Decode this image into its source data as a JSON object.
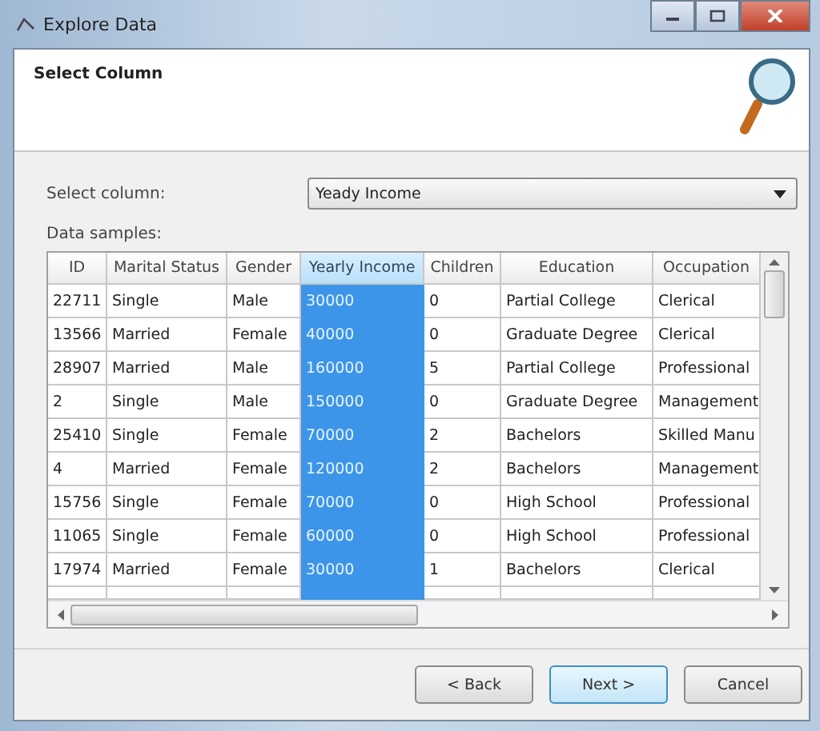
{
  "window": {
    "title": "Explore Data"
  },
  "header": {
    "title": "Select Column"
  },
  "select_column": {
    "label": "Select column:",
    "value": "Yeady Income"
  },
  "data_samples": {
    "label": "Data samples:"
  },
  "table": {
    "columns": [
      {
        "label": "ID",
        "selected": false
      },
      {
        "label": "Marital Status",
        "selected": false
      },
      {
        "label": "Gender",
        "selected": false
      },
      {
        "label": "Yearly Income",
        "selected": true
      },
      {
        "label": "Children",
        "selected": false
      },
      {
        "label": "Education",
        "selected": false
      },
      {
        "label": "Occupation",
        "selected": false
      }
    ],
    "rows": [
      [
        "22711",
        "Single",
        "Male",
        "30000",
        "0",
        "Partial College",
        "Clerical"
      ],
      [
        "13566",
        "Married",
        "Female",
        "40000",
        "0",
        "Graduate Degree",
        "Clerical"
      ],
      [
        "28907",
        "Married",
        "Male",
        "160000",
        "5",
        "Partial College",
        "Professional"
      ],
      [
        "2",
        "Single",
        "Male",
        "150000",
        "0",
        "Graduate Degree",
        "Management"
      ],
      [
        "25410",
        "Single",
        "Female",
        "70000",
        "2",
        "Bachelors",
        "Skilled Manu"
      ],
      [
        "4",
        "Married",
        "Female",
        "120000",
        "2",
        "Bachelors",
        "Management"
      ],
      [
        "15756",
        "Single",
        "Female",
        "70000",
        "0",
        "High School",
        "Professional"
      ],
      [
        "11065",
        "Single",
        "Female",
        "60000",
        "0",
        "High School",
        "Professional"
      ],
      [
        "17974",
        "Married",
        "Female",
        "30000",
        "1",
        "Bachelors",
        "Clerical"
      ]
    ]
  },
  "buttons": [
    {
      "label": "< Back",
      "kind": "normal"
    },
    {
      "label": "Next >",
      "kind": "default"
    },
    {
      "label": "Cancel",
      "kind": "normal"
    }
  ]
}
